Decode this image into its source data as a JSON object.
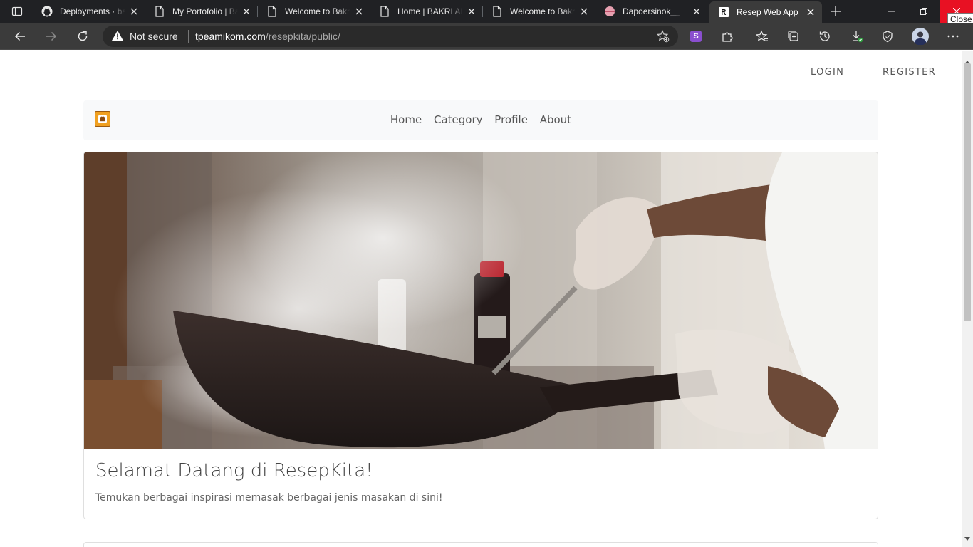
{
  "browser": {
    "tabs": [
      {
        "title": "Deployments · bakriahmad/ResepKita",
        "favicon": "github-icon"
      },
      {
        "title": "My Portofolio | Bakri Ahmad",
        "favicon": "document-icon"
      },
      {
        "title": "Welcome to Bakri Ahmad",
        "favicon": "document-icon"
      },
      {
        "title": "Home | BAKRI AHMAD",
        "favicon": "document-icon"
      },
      {
        "title": "Welcome to Bakri Ahmad",
        "favicon": "document-icon"
      },
      {
        "title": "Dapoersinok__",
        "favicon": "site-icon"
      },
      {
        "title": "Resep Web App",
        "favicon": "r-logo-icon",
        "active": true
      }
    ],
    "close_tooltip": "Close",
    "address_bar": {
      "security_label": "Not secure",
      "url_host": "tpeamikom.com",
      "url_path": "/resepkita/public/"
    },
    "extension_badge": "S"
  },
  "page": {
    "auth": {
      "login": "LOGIN",
      "register": "REGISTER"
    },
    "nav": {
      "items": [
        "Home",
        "Category",
        "Profile",
        "About"
      ]
    },
    "hero": {
      "title": "Selamat Datang di ResepKita!",
      "subtitle": "Temukan berbagai inspirasi memasak berbagai jenis masakan di sini!"
    }
  },
  "colors": {
    "tab_strip": "#202124",
    "toolbar": "#3b3b3b",
    "close_button": "#e81123",
    "navbar_bg": "#f8f9fa",
    "brand_logo": "#f0a020"
  }
}
